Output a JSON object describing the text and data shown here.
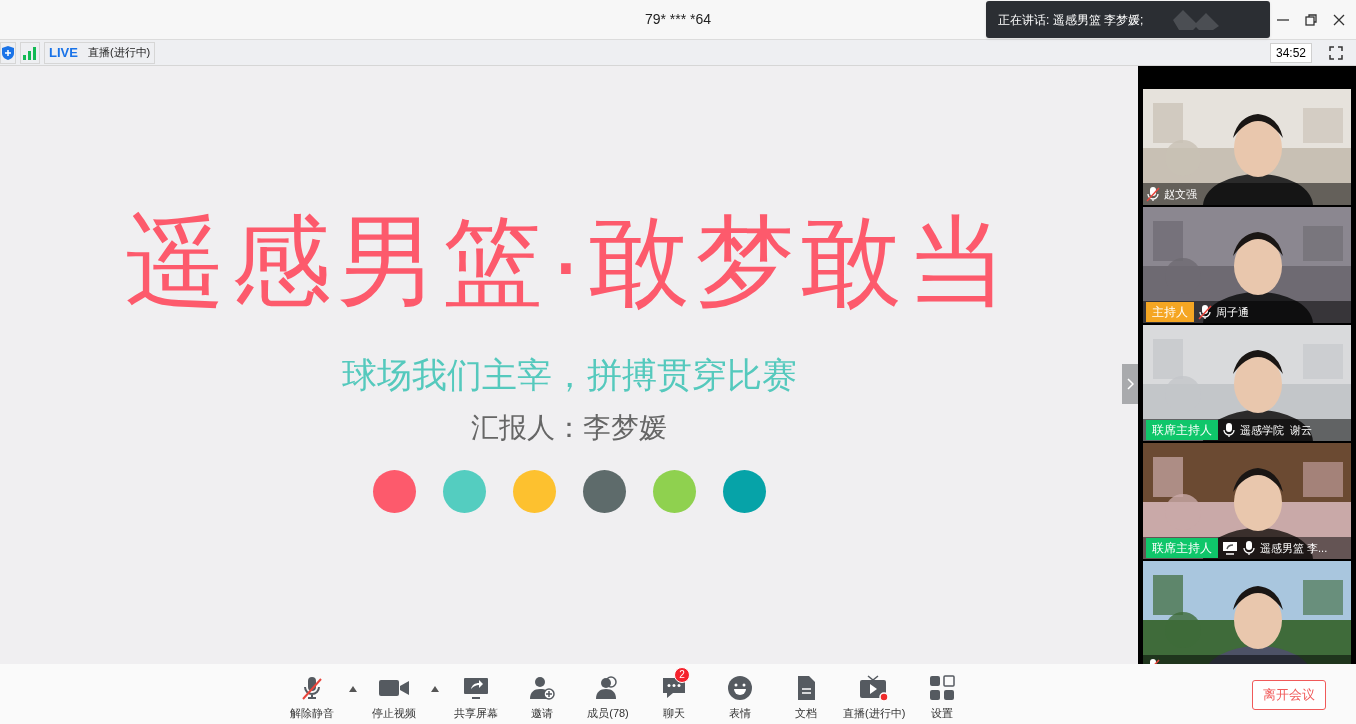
{
  "window": {
    "title": "79* *** *64"
  },
  "speaking_toast": {
    "text": "正在讲话: 遥感男篮 李梦媛;"
  },
  "status_bar": {
    "live_badge": "LIVE",
    "live_label": "直播(进行中)",
    "timer": "34:52"
  },
  "slide": {
    "title": "遥感男篮·敢梦敢当",
    "subtitle": "球场我们主宰，拼搏贯穿比赛",
    "presenter": "汇报人：李梦媛",
    "dots": [
      {
        "color": "#fd5a6c"
      },
      {
        "color": "#54cdc0"
      },
      {
        "color": "#fdc12f"
      },
      {
        "color": "#5e6b6b"
      },
      {
        "color": "#8fd14f"
      },
      {
        "color": "#06a3a8"
      }
    ]
  },
  "participants": [
    {
      "name": "赵文强",
      "muted": true
    },
    {
      "name": "周子通",
      "muted": true,
      "role": {
        "kind": "host",
        "label": "主持人"
      }
    },
    {
      "name": "遥感学院  谢云",
      "muted": false,
      "role": {
        "kind": "cohost",
        "label": "联席主持人"
      }
    },
    {
      "name": "遥感男篮 李...",
      "muted": false,
      "sharing": true,
      "role": {
        "kind": "cohost",
        "label": "联席主持人"
      }
    },
    {
      "muted": true
    }
  ],
  "toolbar": [
    {
      "label": "解除静音",
      "kind": "mic-off",
      "menu": true
    },
    {
      "label": "停止视频",
      "kind": "video",
      "menu": true
    },
    {
      "label": "共享屏幕",
      "kind": "share"
    },
    {
      "label": "邀请",
      "kind": "invite"
    },
    {
      "label": "成员(78)",
      "kind": "members"
    },
    {
      "label": "聊天",
      "kind": "chat",
      "badge": "2"
    },
    {
      "label": "表情",
      "kind": "emoji"
    },
    {
      "label": "文档",
      "kind": "doc"
    },
    {
      "label": "直播(进行中)",
      "kind": "live"
    },
    {
      "label": "设置",
      "kind": "settings"
    }
  ],
  "leave_button": "离开会议"
}
